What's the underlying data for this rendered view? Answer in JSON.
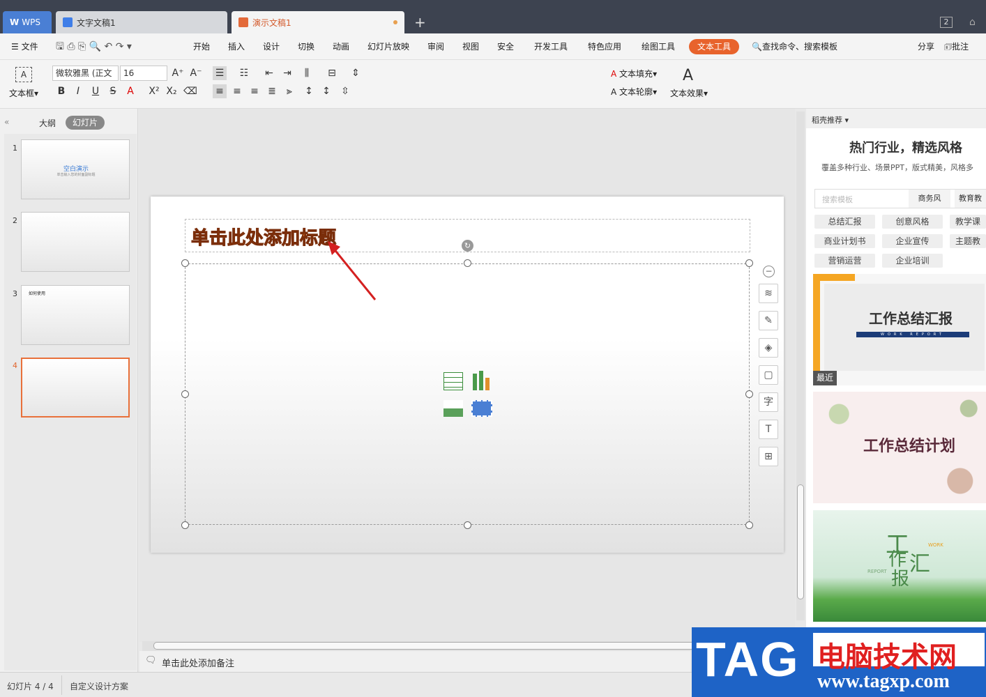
{
  "tabs": {
    "wps": "WPS",
    "doc": "文字文稿1",
    "ppt": "演示文稿1",
    "new": "+",
    "badge": "2"
  },
  "menu": {
    "file": "文件",
    "items": [
      "开始",
      "插入",
      "设计",
      "切换",
      "动画",
      "幻灯片放映",
      "审阅",
      "视图",
      "安全",
      "开发工具",
      "特色应用",
      "绘图工具"
    ],
    "active": "文本工具",
    "search": "查找命令、搜索模板",
    "share": "分享",
    "comment": "批注"
  },
  "ribbon": {
    "textbox": "文本框",
    "font": "微软雅黑 (正文",
    "size": "16",
    "fill": "文本填充",
    "outline": "文本轮廓",
    "effect": "文本效果",
    "art_letter": "A"
  },
  "left": {
    "outline_tab": "大纲",
    "slides_tab": "幻灯片",
    "slides": [
      {
        "num": "1",
        "title": "空白演示",
        "subtitle": "单击输入您的封面副标题"
      },
      {
        "num": "2"
      },
      {
        "num": "3",
        "title": "如何使用"
      },
      {
        "num": "4"
      }
    ]
  },
  "slide": {
    "title": "单击此处添加标题",
    "notes": "单击此处添加备注"
  },
  "right": {
    "header": "稻壳推荐",
    "headline": "热门行业，精选风格",
    "sub": "覆盖多种行业、场景PPT，版式精美，风格多",
    "search_placeholder": "搜索模板",
    "search_tags": [
      "商务风",
      "教育教"
    ],
    "chips": [
      "总结汇报",
      "创意风格",
      "教学课",
      "商业计划书",
      "企业宣传",
      "主题教",
      "营销运营",
      "企业培训"
    ],
    "card1_title": "工作总结汇报",
    "card1_sub": "WORK REPORT",
    "recent": "最近",
    "card2_title": "工作总结计划",
    "card3_chars": [
      "工",
      "作",
      "汇",
      "报"
    ],
    "card3_work": "WORK",
    "card3_report": "REPORT"
  },
  "status": {
    "slide_info": "幻灯片 4 / 4",
    "design": "自定义设计方案"
  },
  "watermark": {
    "tag": "TAG",
    "cn": "电脑技术网",
    "url": "www.tagxp.com"
  }
}
